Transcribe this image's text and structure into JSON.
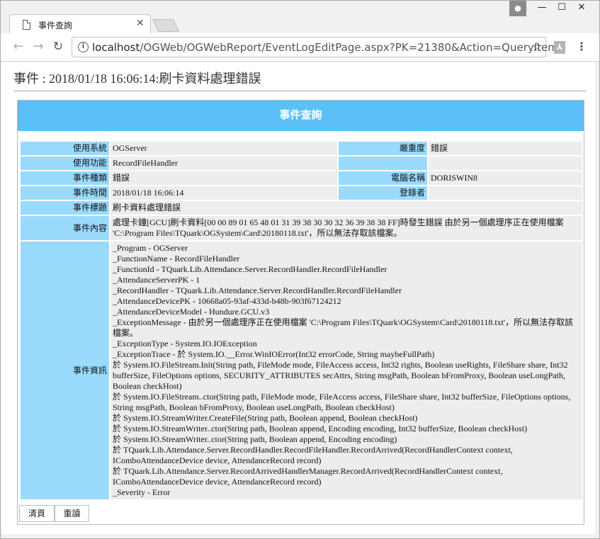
{
  "browser": {
    "tab_title": "事件查詢",
    "url_host": "localhost",
    "url_path": "/OGWeb/OGWebReport/EventLogEditPage.aspx?PK=21380&Action=QueryItem"
  },
  "page": {
    "event_title": "事件 : 2018/01/18 16:06:14:刷卡資料處理錯誤",
    "panel_heading": "事件查詢"
  },
  "fields": {
    "system_label": "使用系統",
    "system_value": "OGServer",
    "severity_label": "嚴重度",
    "severity_value": "錯誤",
    "function_label": "使用功能",
    "function_value": "RecordFileHandler",
    "type_label": "事件種類",
    "type_value": "錯誤",
    "computer_label": "電腦名稱",
    "computer_value": "DORISWIN8",
    "time_label": "事件時間",
    "time_value": "2018/01/18 16:06:14",
    "login_label": "登錄者",
    "login_value": "",
    "subject_label": "事件標題",
    "subject_value": "刷卡資料處理錯誤",
    "content_label": "事件內容",
    "content_value": "處理卡鐘[GCU]刷卡資料[00 00 89 01 65 48 01 31 39 38 30 30 32 36 39 38 38 FF]時發生錯誤 由於另一個處理序正在使用檔案 'C:\\Program Files\\TQuark\\OGSystem\\Card\\20180118.txt'，所以無法存取該檔案。",
    "info_label": "事件資訊",
    "info_value": "_Program - OGServer\n_FunctionName - RecordFileHandler\n_FunctionId - TQuark.Lib.Attendance.Server.RecordHandler.RecordFileHandler\n_AttendanceServerPK - 1\n_RecordHandler - TQuark.Lib.Attendance.Server.RecordHandler.RecordFileHandler\n_AttendanceDevicePK - 10668a05-93af-433d-b48b-903f67124212\n_AttendanceDeviceModel - Hundure.GCU.v3\n_ExceptionMessage - 由於另一個處理序正在使用檔案 'C:\\Program Files\\TQuark\\OGSystem\\Card\\20180118.txt'，所以無法存取該檔案。\n_ExceptionType - System.IO.IOException\n_ExceptionTrace - 於 System.IO.__Error.WinIOError(Int32 errorCode, String maybeFullPath)\n於 System.IO.FileStream.Init(String path, FileMode mode, FileAccess access, Int32 rights, Boolean useRights, FileShare share, Int32 bufferSize, FileOptions options, SECURITY_ATTRIBUTES secAttrs, String msgPath, Boolean bFromProxy, Boolean useLongPath, Boolean checkHost)\n於 System.IO.FileStream..ctor(String path, FileMode mode, FileAccess access, FileShare share, Int32 bufferSize, FileOptions options, String msgPath, Boolean bFromProxy, Boolean useLongPath, Boolean checkHost)\n於 System.IO.StreamWriter.CreateFile(String path, Boolean append, Boolean checkHost)\n於 System.IO.StreamWriter..ctor(String path, Boolean append, Encoding encoding, Int32 bufferSize, Boolean checkHost)\n於 System.IO.StreamWriter..ctor(String path, Boolean append, Encoding encoding)\n於 TQuark.Lib.Attendance.Server.RecordHandler.RecordFileHandler.RecordArrived(RecordHandlerContext context, IComboAttendanceDevice device, AttendanceRecord record)\n於 TQuark.Lib.Attendance.Server.RecordArrivedHandlerManager.RecordArrived(RecordHandlerContext context, IComboAttendanceDevice device, AttendanceRecord record)\n_Severity - Error"
  },
  "actions": {
    "clear_label": "清頁",
    "reread_label": "重讀"
  },
  "colors": {
    "header_bg": "#5bc0f8",
    "label_bg": "#99dafd",
    "value_bg": "#ededed"
  }
}
